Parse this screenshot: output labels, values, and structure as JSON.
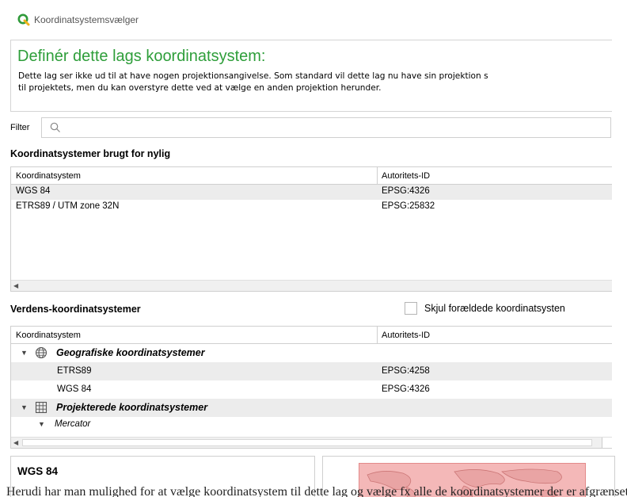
{
  "window": {
    "title": "Koordinatsystemsvælger"
  },
  "info": {
    "heading": "Definér dette lags koordinatsystem:",
    "description_line1": "Dette lag ser ikke ud til at have nogen projektionsangivelse. Som standard vil dette lag nu have sin projektion s",
    "description_line2": "til projektets, men du kan overstyre dette ved at vælge en anden projektion herunder."
  },
  "filter": {
    "label": "Filter",
    "value": ""
  },
  "recent": {
    "section_label": "Koordinatsystemer brugt for nylig",
    "columns": [
      "Koordinatsystem",
      "Autoritets-ID"
    ],
    "rows": [
      {
        "name": "WGS 84",
        "id": "EPSG:4326"
      },
      {
        "name": "ETRS89 / UTM zone 32N",
        "id": "EPSG:25832"
      }
    ]
  },
  "world": {
    "section_label": "Verdens-koordinatsystemer",
    "hide_deprecated_label": "Skjul forældede koordinatsysten",
    "hide_deprecated_checked": false,
    "columns": [
      "Koordinatsystem",
      "Autoritets-ID"
    ],
    "groups": [
      {
        "name": "Geografiske koordinatsystemer",
        "icon": "globe-icon",
        "items": [
          {
            "name": "ETRS89",
            "id": "EPSG:4258"
          },
          {
            "name": "WGS 84",
            "id": "EPSG:4326"
          }
        ]
      },
      {
        "name": "Projekterede koordinatsystemer",
        "icon": "grid-icon",
        "subgroups": [
          {
            "name": "Mercator"
          }
        ]
      }
    ]
  },
  "selected": {
    "name": "WGS 84"
  },
  "footer_text": "Herudi har man mulighed for at vælge koordinatsystem til dette lag og vælge fx alle de koordinatsystemer der er afgrænset for Danmark. Se"
}
